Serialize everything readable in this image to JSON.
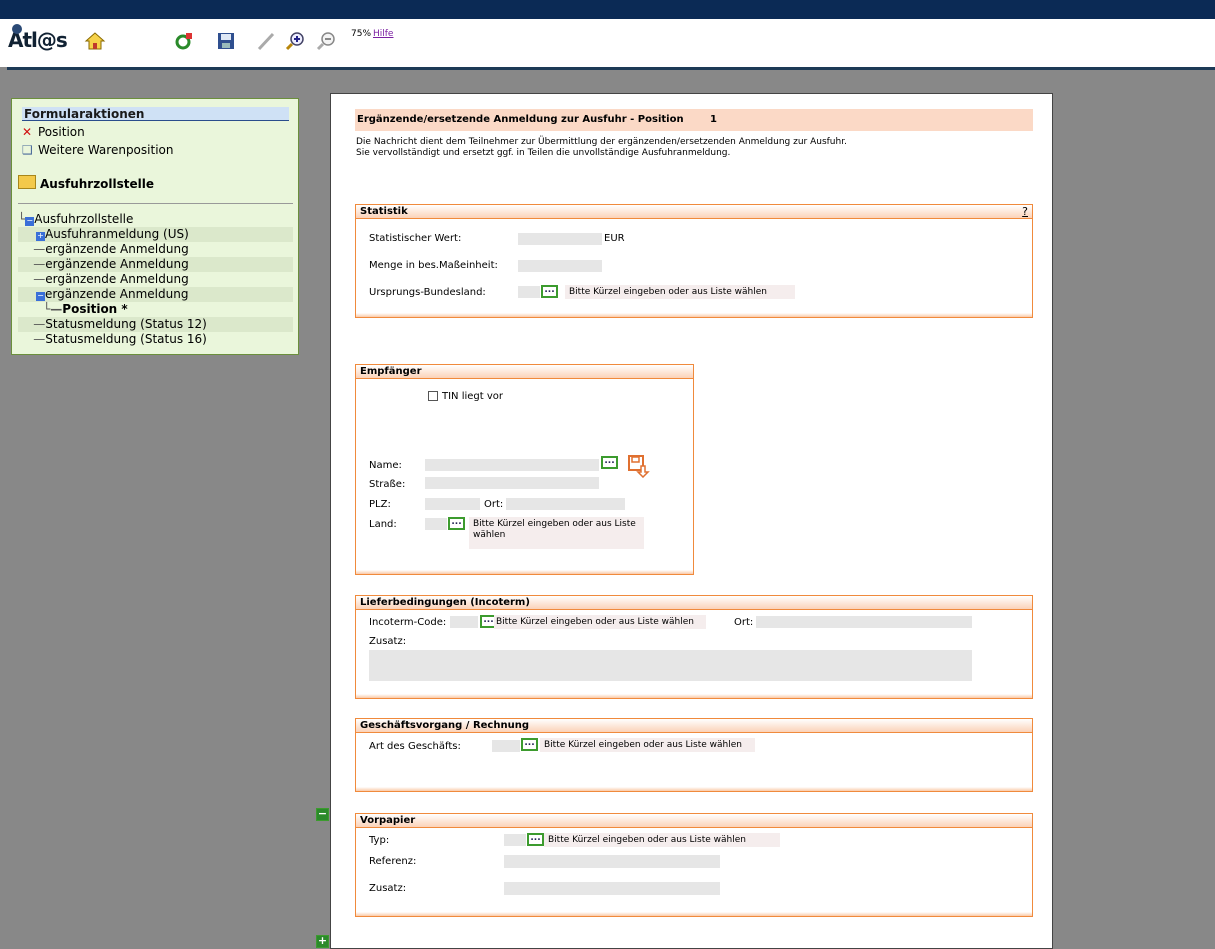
{
  "toolbar": {
    "logo": "Atl@s",
    "zoom": "75%",
    "help": "Hilfe"
  },
  "left": {
    "title": "Formularaktionen",
    "actions": [
      "Position",
      "Weitere Warenposition"
    ],
    "folder": "Ausfuhrzollstelle",
    "tree": [
      "Ausfuhrzollstelle",
      "Ausfuhranmeldung (US)",
      "ergänzende Anmeldung",
      "ergänzende Anmeldung",
      "ergänzende Anmeldung",
      "ergänzende Anmeldung",
      "Position *",
      "Statusmeldung (Status 12)",
      "Statusmeldung (Status 16)"
    ]
  },
  "doc": {
    "title": "Ergänzende/ersetzende Anmeldung zur Ausfuhr - Position",
    "position_no": "1",
    "desc1": "Die Nachricht dient dem Teilnehmer zur Übermittlung der ergänzenden/ersetzenden Anmeldung zur Ausfuhr.",
    "desc2": "Sie vervollständigt und ersetzt ggf. in Teilen die unvollständige Ausfuhranmeldung."
  },
  "statistik": {
    "title": "Statistik",
    "help": "?",
    "wert_label": "Statistischer Wert:",
    "currency": "EUR",
    "menge_label": "Menge in bes.Maßeinheit:",
    "bundesland_label": "Ursprungs-Bundesland:",
    "hint": "Bitte Kürzel eingeben oder aus Liste wählen"
  },
  "empfaenger": {
    "title": "Empfänger",
    "tin_label": "TIN liegt vor",
    "name_label": "Name:",
    "strasse_label": "Straße:",
    "plz_label": "PLZ:",
    "ort_label": "Ort:",
    "land_label": "Land:",
    "hint": "Bitte Kürzel eingeben oder aus Liste wählen"
  },
  "liefer": {
    "title": "Lieferbedingungen (Incoterm)",
    "code_label": "Incoterm-Code:",
    "hint": "Bitte Kürzel eingeben oder aus Liste wählen",
    "ort_label": "Ort:",
    "zusatz_label": "Zusatz:"
  },
  "geschaeft": {
    "title": "Geschäftsvorgang / Rechnung",
    "art_label": "Art des Geschäfts:",
    "hint": "Bitte Kürzel eingeben oder aus Liste wählen"
  },
  "vorpapier": {
    "title": "Vorpapier",
    "typ_label": "Typ:",
    "hint": "Bitte Kürzel eingeben oder aus Liste wählen",
    "referenz_label": "Referenz:",
    "zusatz_label": "Zusatz:"
  },
  "picker_glyph": "..."
}
